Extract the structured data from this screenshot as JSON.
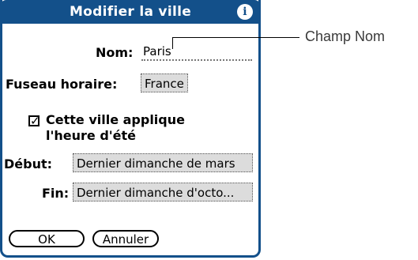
{
  "dialog": {
    "title": "Modifier la ville",
    "info_icon": "i",
    "name_label": "Nom:",
    "name_value": "Paris",
    "timezone_label": "Fuseau horaire:",
    "timezone_value": "France",
    "dst_checkbox_checked": true,
    "dst_checkbox_glyph": "✓",
    "dst_label_line1": "Cette ville applique",
    "dst_label_line2": "l'heure d'été",
    "start_label": "Début:",
    "start_value": "Dernier dimanche de mars",
    "end_label": "Fin:",
    "end_value": "Dernier dimanche d'octo...",
    "ok_button": "OK",
    "cancel_button": "Annuler"
  },
  "callout": {
    "text": "Champ Nom"
  },
  "colors": {
    "titlebar": "#13508a",
    "trigger_bg": "#dcdcdc"
  }
}
